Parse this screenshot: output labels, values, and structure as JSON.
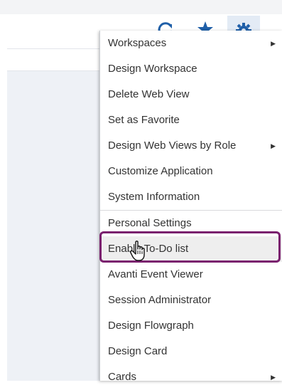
{
  "toolbar": {
    "icons": [
      "refresh-icon",
      "star-icon",
      "gear-icon"
    ]
  },
  "menu": {
    "items": [
      {
        "label": "Workspaces",
        "submenu": true
      },
      {
        "label": "Design Workspace",
        "submenu": false
      },
      {
        "label": "Delete Web View",
        "submenu": false
      },
      {
        "label": "Set as Favorite",
        "submenu": false
      },
      {
        "label": "Design Web Views by Role",
        "submenu": true
      },
      {
        "label": "Customize Application",
        "submenu": false
      },
      {
        "label": "System Information",
        "submenu": false
      },
      {
        "label": "Personal Settings",
        "submenu": false
      },
      {
        "label": "Enable To-Do list",
        "submenu": false,
        "hovered": true
      },
      {
        "label": "Avanti Event Viewer",
        "submenu": false
      },
      {
        "label": "Session Administrator",
        "submenu": false
      },
      {
        "label": "Design Flowgraph",
        "submenu": false
      },
      {
        "label": "Design Card",
        "submenu": false
      },
      {
        "label": "Cards",
        "submenu": true
      }
    ],
    "arrow_glyph": "▶"
  },
  "colors": {
    "highlight_border": "#7a1f6e",
    "toolbar_icon": "#1f5fa8"
  }
}
